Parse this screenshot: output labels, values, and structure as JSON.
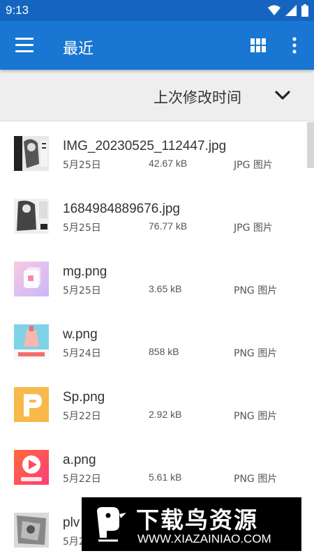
{
  "status_bar": {
    "time": "9:13",
    "icons": [
      "wifi-icon",
      "signal-icon",
      "battery-icon"
    ]
  },
  "app_bar": {
    "title": "最近",
    "actions": [
      "grid-view-icon",
      "more-options-icon"
    ]
  },
  "sort_bar": {
    "label": "上次修改时间",
    "icon": "chevron-down-icon"
  },
  "files": [
    {
      "name": "IMG_20230525_112447.jpg",
      "date": "5月25日",
      "size": "42.67 kB",
      "type": "JPG 图片"
    },
    {
      "name": "1684984889676.jpg",
      "date": "5月25日",
      "size": "76.77 kB",
      "type": "JPG 图片"
    },
    {
      "name": "mg.png",
      "date": "5月25日",
      "size": "3.65 kB",
      "type": "PNG 图片"
    },
    {
      "name": "w.png",
      "date": "5月24日",
      "size": "858 kB",
      "type": "PNG 图片"
    },
    {
      "name": "Sp.png",
      "date": "5月22日",
      "size": "2.92 kB",
      "type": "PNG 图片"
    },
    {
      "name": "a.png",
      "date": "5月22日",
      "size": "5.61 kB",
      "type": "PNG 图片"
    },
    {
      "name": "plv",
      "date": "5月2",
      "size": "",
      "type": ""
    }
  ],
  "watermark": {
    "title": "下载鸟资源",
    "url": "WWW.XIAZAINIAO.COM"
  },
  "colors": {
    "app_bar": "#1976d2",
    "status_bar": "#1565c0",
    "sort_bar": "#eeeeee"
  }
}
